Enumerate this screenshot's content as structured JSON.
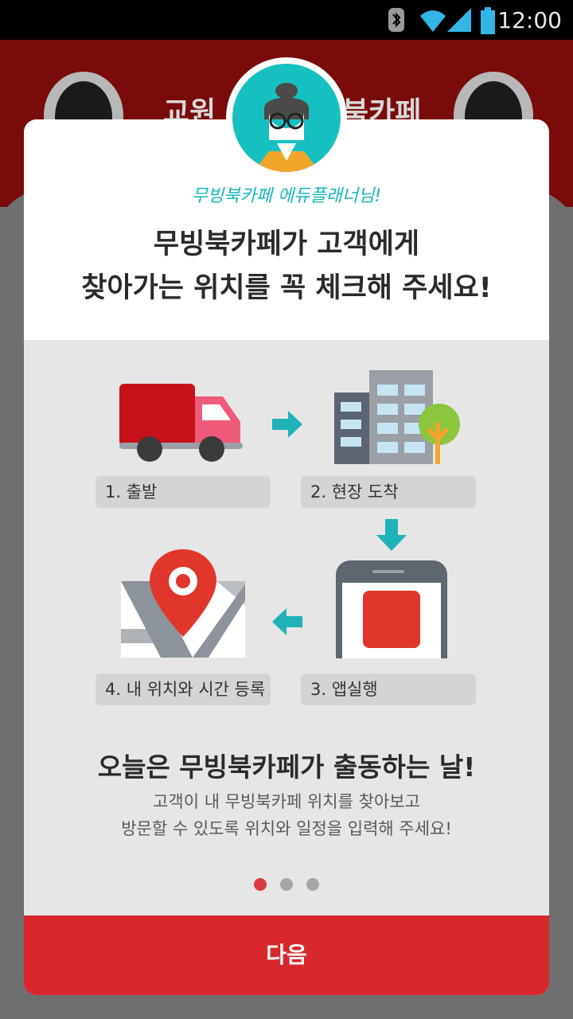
{
  "status_bar": {
    "time": "12:00"
  },
  "background": {
    "title_left": "교원",
    "title_right": "북카페"
  },
  "modal": {
    "subtitle": "무빙북카페 에듀플래너님!",
    "headline_line1": "무빙북카페가 고객에게",
    "headline_line2": "찾아가는 위치를 꼭 체크해 주세요!",
    "steps": [
      {
        "label": "1. 출발",
        "icon": "truck-icon"
      },
      {
        "label": "2. 현장 도착",
        "icon": "building-icon"
      },
      {
        "label": "3. 앱실행",
        "icon": "phone-icon"
      },
      {
        "label": "4. 내 위치와 시간 등록",
        "icon": "map-pin-icon"
      }
    ],
    "bottom_title": "오늘은 무빙북카페가 출동하는 날!",
    "bottom_desc_line1": "고객이 내 무빙북카페 위치를 찾아보고",
    "bottom_desc_line2": "방문할 수 있도록 위치와 일정을 입력해 주세요!",
    "page_indicator": {
      "current": 1,
      "total": 3
    },
    "next_button": "다음"
  },
  "colors": {
    "accent": "#d8282e",
    "teal": "#17c0c0",
    "arrow": "#1fb3b8"
  }
}
